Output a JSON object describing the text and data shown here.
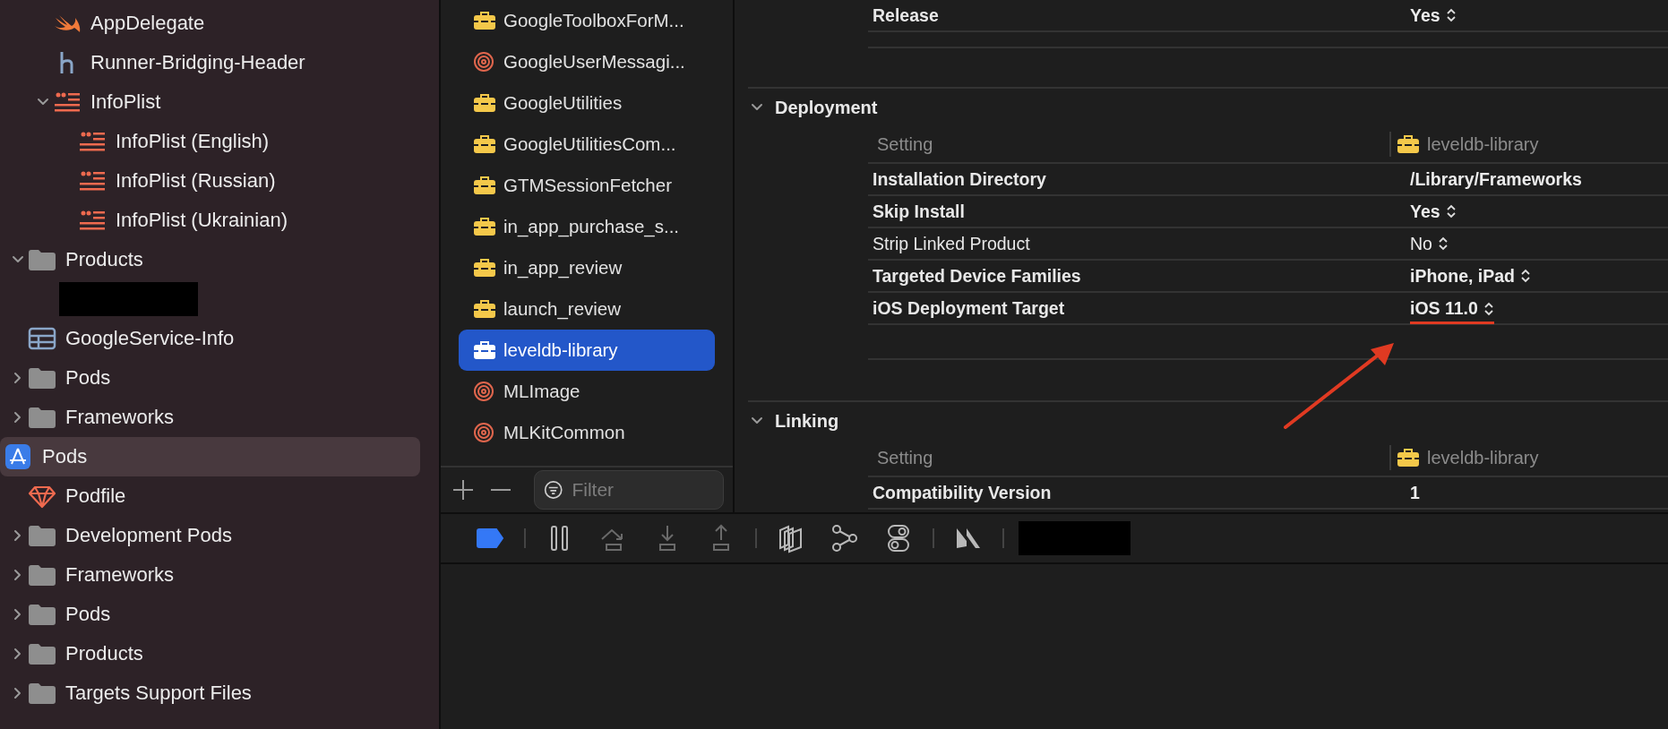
{
  "navigator": {
    "items": [
      {
        "kind": "continued",
        "children": [
          {
            "kind": "continued",
            "children": [
              {
                "kind": "swift",
                "label": "AppDelegate"
              },
              {
                "kind": "header",
                "label": "Runner-Bridging-Header"
              },
              {
                "kind": "strings",
                "label": "InfoPlist",
                "expanded": true,
                "children": [
                  {
                    "kind": "strings",
                    "label": "InfoPlist (English)"
                  },
                  {
                    "kind": "strings",
                    "label": "InfoPlist (Russian)"
                  },
                  {
                    "kind": "strings",
                    "label": "InfoPlist (Ukrainian)"
                  }
                ]
              }
            ]
          },
          {
            "kind": "folder",
            "label": "Products",
            "expanded": true,
            "children": [
              {
                "kind": "redacted"
              }
            ]
          },
          {
            "kind": "plist",
            "label": "GoogleService-Info"
          },
          {
            "kind": "folder",
            "label": "Pods",
            "expanded": false
          },
          {
            "kind": "folder",
            "label": "Frameworks",
            "expanded": false
          }
        ]
      },
      {
        "kind": "project",
        "label": "Pods",
        "selected": true,
        "children": [
          {
            "kind": "ruby",
            "label": "Podfile"
          },
          {
            "kind": "folder",
            "label": "Development Pods",
            "expanded": false
          },
          {
            "kind": "folder",
            "label": "Frameworks",
            "expanded": false
          },
          {
            "kind": "folder",
            "label": "Pods",
            "expanded": false
          },
          {
            "kind": "folder",
            "label": "Products",
            "expanded": false
          },
          {
            "kind": "folder",
            "label": "Targets Support Files",
            "expanded": false
          }
        ]
      }
    ]
  },
  "targets": {
    "items": [
      {
        "kind": "framework",
        "label": "GoogleToolboxForM...",
        "selected": false
      },
      {
        "kind": "target",
        "label": "GoogleUserMessagi...",
        "selected": false
      },
      {
        "kind": "framework",
        "label": "GoogleUtilities",
        "selected": false
      },
      {
        "kind": "framework",
        "label": "GoogleUtilitiesCom...",
        "selected": false
      },
      {
        "kind": "framework",
        "label": "GTMSessionFetcher",
        "selected": false
      },
      {
        "kind": "framework",
        "label": "in_app_purchase_s...",
        "selected": false
      },
      {
        "kind": "framework",
        "label": "in_app_review",
        "selected": false
      },
      {
        "kind": "framework",
        "label": "launch_review",
        "selected": false
      },
      {
        "kind": "framework",
        "label": "leveldb-library",
        "selected": true
      },
      {
        "kind": "target",
        "label": "MLImage",
        "selected": false
      },
      {
        "kind": "target",
        "label": "MLKitCommon",
        "selected": false
      }
    ],
    "filter": {
      "placeholder": "Filter"
    }
  },
  "build_settings": {
    "sections": [
      {
        "kind": "continued",
        "rows": [
          {
            "setting": "Release",
            "value": "Yes",
            "bold": true,
            "popup": true,
            "underlined": false
          }
        ]
      },
      {
        "kind": "section",
        "title": "Deployment",
        "expanded": true,
        "column_header": {
          "label": "Setting",
          "target": "leveldb-library"
        },
        "rows": [
          {
            "setting": "Installation Directory",
            "value": "/Library/Frameworks",
            "bold": true,
            "popup": false,
            "underlined": false
          },
          {
            "setting": "Skip Install",
            "value": "Yes",
            "bold": true,
            "popup": true,
            "underlined": false
          },
          {
            "setting": "Strip Linked Product",
            "value": "No",
            "bold": false,
            "popup": true,
            "underlined": false
          },
          {
            "setting": "Targeted Device Families",
            "value": "iPhone, iPad",
            "bold": true,
            "popup": true,
            "underlined": false
          },
          {
            "setting": "iOS Deployment Target",
            "value": "iOS 11.0",
            "bold": true,
            "popup": true,
            "underlined": true
          }
        ]
      },
      {
        "kind": "section",
        "title": "Linking",
        "expanded": true,
        "column_header": {
          "label": "Setting",
          "target": "leveldb-library"
        },
        "rows": [
          {
            "setting": "Compatibility Version",
            "value": "1",
            "bold": true,
            "popup": false,
            "underlined": false
          }
        ]
      }
    ],
    "annotations": [
      {
        "kind": "arrow"
      }
    ]
  },
  "debug_bar": {
    "items": [
      {
        "kind": "breakpoints",
        "on": true
      },
      {
        "kind": "separator"
      },
      {
        "kind": "pause",
        "disabled": false
      },
      {
        "kind": "step-over",
        "disabled": true
      },
      {
        "kind": "step-into",
        "disabled": true
      },
      {
        "kind": "step-out",
        "disabled": true
      },
      {
        "kind": "separator"
      },
      {
        "kind": "view-debugger",
        "disabled": false
      },
      {
        "kind": "memory-graph",
        "disabled": false
      },
      {
        "kind": "environment",
        "disabled": false
      },
      {
        "kind": "separator"
      },
      {
        "kind": "location",
        "disabled": false
      },
      {
        "kind": "separator"
      },
      {
        "kind": "redacted"
      }
    ]
  }
}
